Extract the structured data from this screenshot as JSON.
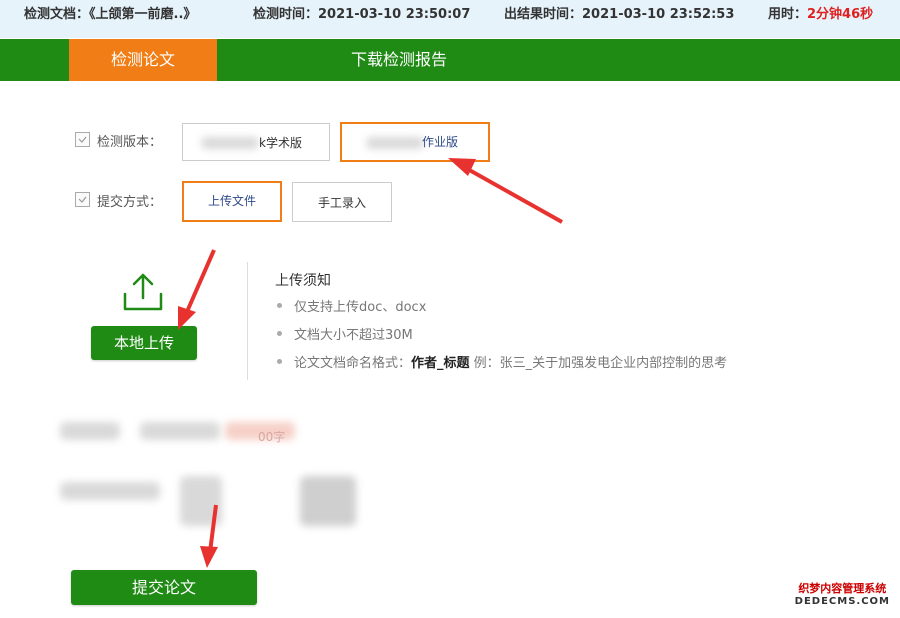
{
  "info": {
    "doc_label": "检测文档：",
    "doc_value": "《上颌第一前磨..》",
    "check_time_label": "检测时间：",
    "check_time_value": "2021-03-10 23:50:07",
    "result_time_label": "出结果时间：",
    "result_time_value": "2021-03-10 23:52:53",
    "elapsed_label": "用时：",
    "elapsed_value": "2分钟46秒"
  },
  "nav": {
    "tabs": [
      {
        "label": "检测论文",
        "active": true
      },
      {
        "label": "下载检测报告",
        "active": false
      }
    ]
  },
  "form": {
    "version_label": "检测版本：",
    "version_options": [
      {
        "label": "k学术版",
        "selected": false
      },
      {
        "label": "作业版",
        "selected": true
      }
    ],
    "submit_mode_label": "提交方式：",
    "submit_options": [
      {
        "label": "上传文件",
        "selected": true
      },
      {
        "label": "手工录入",
        "selected": false
      }
    ]
  },
  "upload": {
    "button_label": "本地上传",
    "notes_title": "上传须知",
    "notes": [
      {
        "text": "仅支持上传doc、docx"
      },
      {
        "text": "文档大小不超过30M"
      },
      {
        "prefix": "论文文档命名格式：",
        "bold": "作者_标题",
        "suffix": " 例：张三_关于加强发电企业内部控制的思考"
      }
    ]
  },
  "blurred_text": "00字",
  "submit_button_label": "提交论文",
  "watermark": {
    "line1": "织梦内容管理系统",
    "line2": "DEDECMS.COM"
  },
  "colors": {
    "green": "#1f8a14",
    "orange": "#f07d15",
    "red": "#e02020",
    "info_bg": "#e6f3fb"
  }
}
